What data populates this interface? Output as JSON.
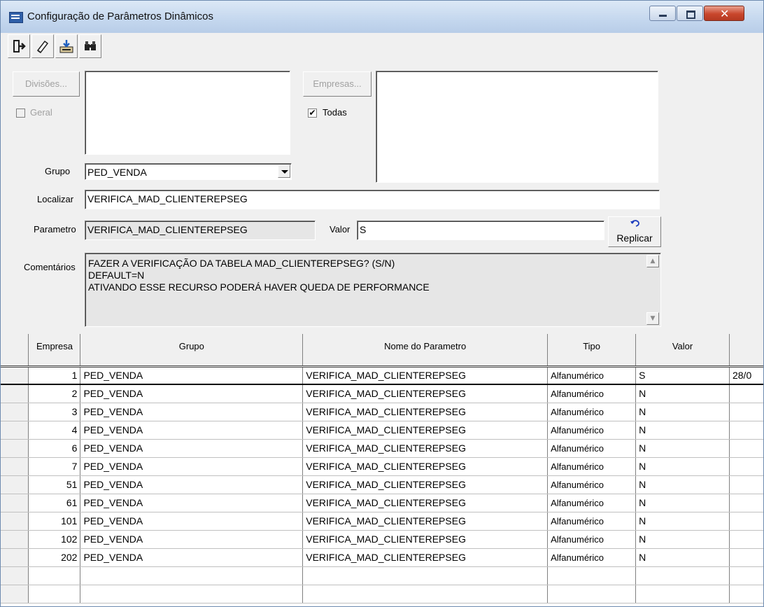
{
  "window": {
    "title": "Configuração de Parâmetros Dinâmicos",
    "close_glyph": "✕"
  },
  "toolbar": {
    "icons": [
      "exit-icon",
      "eraser-icon",
      "save-download-icon",
      "binoculars-icon"
    ]
  },
  "filters": {
    "divisoes_button": "Divisões...",
    "geral_label": "Geral",
    "geral_checked": false,
    "empresas_button": "Empresas...",
    "todas_label": "Todas",
    "todas_checked": true
  },
  "form": {
    "grupo_label": "Grupo",
    "grupo_value": "PED_VENDA",
    "localizar_label": "Localizar",
    "localizar_value": "VERIFICA_MAD_CLIENTEREPSEG",
    "parametro_label": "Parametro",
    "parametro_value": "VERIFICA_MAD_CLIENTEREPSEG",
    "valor_label": "Valor",
    "valor_value": "S",
    "replicar_label": "Replicar",
    "comentarios_label": "Comentários",
    "comentarios_lines": [
      "FAZER A VERIFICAÇÃO DA TABELA MAD_CLIENTEREPSEG? (S/N)",
      "DEFAULT=N",
      "ATIVANDO ESSE RECURSO PODERÁ HAVER QUEDA DE PERFORMANCE"
    ]
  },
  "grid": {
    "columns": [
      "Empresa",
      "Grupo",
      "Nome do Parametro",
      "Tipo",
      "Valor",
      ""
    ],
    "rows": [
      {
        "empresa": "1",
        "grupo": "PED_VENDA",
        "nome": "VERIFICA_MAD_CLIENTEREPSEG",
        "tipo": "Alfanumérico",
        "valor": "S",
        "extra": "28/0"
      },
      {
        "empresa": "2",
        "grupo": "PED_VENDA",
        "nome": "VERIFICA_MAD_CLIENTEREPSEG",
        "tipo": "Alfanumérico",
        "valor": "N",
        "extra": ""
      },
      {
        "empresa": "3",
        "grupo": "PED_VENDA",
        "nome": "VERIFICA_MAD_CLIENTEREPSEG",
        "tipo": "Alfanumérico",
        "valor": "N",
        "extra": ""
      },
      {
        "empresa": "4",
        "grupo": "PED_VENDA",
        "nome": "VERIFICA_MAD_CLIENTEREPSEG",
        "tipo": "Alfanumérico",
        "valor": "N",
        "extra": ""
      },
      {
        "empresa": "6",
        "grupo": "PED_VENDA",
        "nome": "VERIFICA_MAD_CLIENTEREPSEG",
        "tipo": "Alfanumérico",
        "valor": "N",
        "extra": ""
      },
      {
        "empresa": "7",
        "grupo": "PED_VENDA",
        "nome": "VERIFICA_MAD_CLIENTEREPSEG",
        "tipo": "Alfanumérico",
        "valor": "N",
        "extra": ""
      },
      {
        "empresa": "51",
        "grupo": "PED_VENDA",
        "nome": "VERIFICA_MAD_CLIENTEREPSEG",
        "tipo": "Alfanumérico",
        "valor": "N",
        "extra": ""
      },
      {
        "empresa": "61",
        "grupo": "PED_VENDA",
        "nome": "VERIFICA_MAD_CLIENTEREPSEG",
        "tipo": "Alfanumérico",
        "valor": "N",
        "extra": ""
      },
      {
        "empresa": "101",
        "grupo": "PED_VENDA",
        "nome": "VERIFICA_MAD_CLIENTEREPSEG",
        "tipo": "Alfanumérico",
        "valor": "N",
        "extra": ""
      },
      {
        "empresa": "102",
        "grupo": "PED_VENDA",
        "nome": "VERIFICA_MAD_CLIENTEREPSEG",
        "tipo": "Alfanumérico",
        "valor": "N",
        "extra": ""
      },
      {
        "empresa": "202",
        "grupo": "PED_VENDA",
        "nome": "VERIFICA_MAD_CLIENTEREPSEG",
        "tipo": "Alfanumérico",
        "valor": "N",
        "extra": ""
      },
      {
        "empresa": "",
        "grupo": "",
        "nome": "",
        "tipo": "",
        "valor": "",
        "extra": ""
      },
      {
        "empresa": "",
        "grupo": "",
        "nome": "",
        "tipo": "",
        "valor": "",
        "extra": ""
      }
    ],
    "selected_row": 0
  }
}
